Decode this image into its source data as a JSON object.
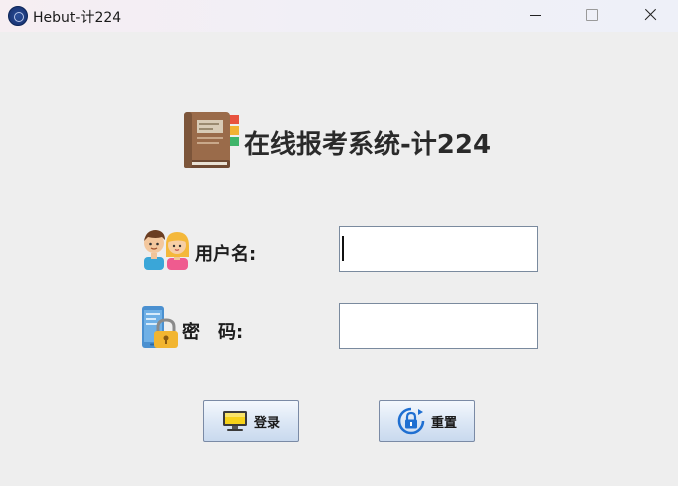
{
  "window": {
    "title": "Hebut-计224",
    "icon": "hebut-logo-icon",
    "controls": [
      "minimize-icon",
      "maximize-icon",
      "close-icon"
    ]
  },
  "header": {
    "icon": "book-icon",
    "title": "在线报考系统-计224"
  },
  "form": {
    "username": {
      "icon": "users-icon",
      "label": "用户名:",
      "value": ""
    },
    "password": {
      "icon": "lock-phone-icon",
      "label": "密　码:",
      "value": ""
    }
  },
  "buttons": {
    "login": {
      "icon": "computer-icon",
      "label": "登录"
    },
    "reset": {
      "icon": "lock-refresh-icon",
      "label": "重置"
    }
  },
  "colors": {
    "background": "#eeeeee",
    "button_gradient_top": "#f4f8fd",
    "button_gradient_bottom": "#c9d9ee",
    "field_border": "#7a8a9e"
  }
}
